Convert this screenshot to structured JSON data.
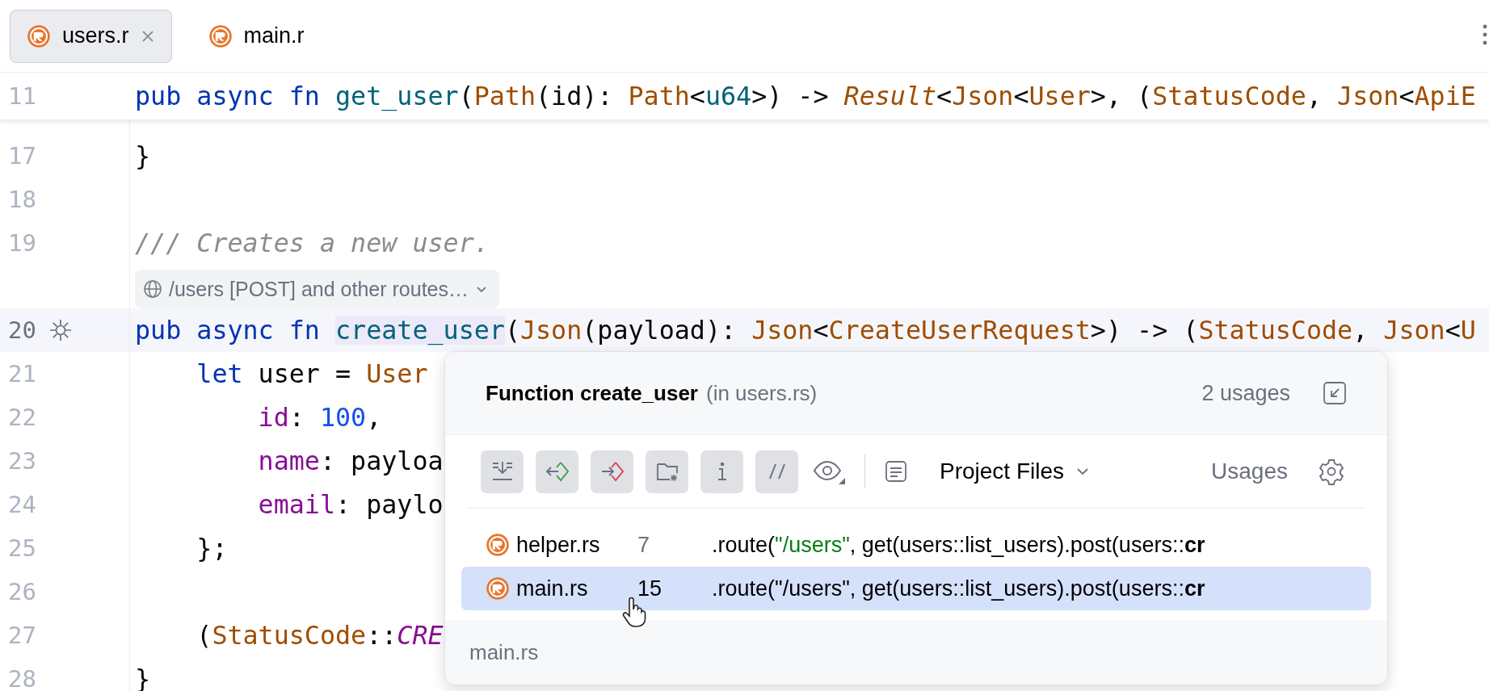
{
  "tabs": [
    {
      "label": "users.r",
      "selected": true,
      "closable": true
    },
    {
      "label": "main.r",
      "selected": false,
      "closable": false
    }
  ],
  "sticky_line": {
    "number": "11",
    "tokens": [
      {
        "text": "pub async fn ",
        "kind": "keyword"
      },
      {
        "text": "get_user",
        "kind": "function"
      },
      {
        "text": "(",
        "kind": "plain"
      },
      {
        "text": "Path",
        "kind": "type"
      },
      {
        "text": "(id): ",
        "kind": "plain"
      },
      {
        "text": "Path",
        "kind": "type"
      },
      {
        "text": "<",
        "kind": "plain"
      },
      {
        "text": "u64",
        "kind": "primitive"
      },
      {
        "text": ">) -> ",
        "kind": "plain"
      },
      {
        "text": "Result",
        "kind": "type_italic"
      },
      {
        "text": "<",
        "kind": "plain"
      },
      {
        "text": "Json",
        "kind": "type"
      },
      {
        "text": "<",
        "kind": "plain"
      },
      {
        "text": "User",
        "kind": "type"
      },
      {
        "text": ">, (",
        "kind": "plain"
      },
      {
        "text": "StatusCode",
        "kind": "type"
      },
      {
        "text": ", ",
        "kind": "plain"
      },
      {
        "text": "Json",
        "kind": "type"
      },
      {
        "text": "<",
        "kind": "plain"
      },
      {
        "text": "ApiE",
        "kind": "type"
      }
    ]
  },
  "code_lines": [
    {
      "kind": "code",
      "number": "17",
      "current": false,
      "gutter_icon": false,
      "tokens": [
        {
          "text": "}",
          "kind": "plain"
        }
      ]
    },
    {
      "kind": "code",
      "number": "18",
      "current": false,
      "gutter_icon": false
    },
    {
      "kind": "code",
      "number": "19",
      "current": false,
      "gutter_icon": false,
      "tokens": [
        {
          "text": "/// Creates a new user.",
          "kind": "comment"
        }
      ]
    },
    {
      "kind": "hint",
      "text": "/users [POST] and other routes…"
    },
    {
      "kind": "code",
      "number": "20",
      "current": true,
      "gutter_icon": true,
      "tokens": [
        {
          "text": "pub async fn ",
          "kind": "keyword"
        },
        {
          "text": "create_user",
          "kind": "usage"
        },
        {
          "text": "(",
          "kind": "plain"
        },
        {
          "text": "Json",
          "kind": "type"
        },
        {
          "text": "(payload): ",
          "kind": "plain"
        },
        {
          "text": "Json",
          "kind": "type"
        },
        {
          "text": "<",
          "kind": "plain"
        },
        {
          "text": "CreateUserRequest",
          "kind": "type"
        },
        {
          "text": ">) -> (",
          "kind": "plain"
        },
        {
          "text": "StatusCode",
          "kind": "type"
        },
        {
          "text": ", ",
          "kind": "plain"
        },
        {
          "text": "Json",
          "kind": "type"
        },
        {
          "text": "<",
          "kind": "plain"
        },
        {
          "text": "U",
          "kind": "type"
        }
      ]
    },
    {
      "kind": "code",
      "number": "21",
      "current": false,
      "gutter_icon": false,
      "tokens": [
        {
          "text": "    let",
          "kind": "keyword"
        },
        {
          "text": " user = ",
          "kind": "plain"
        },
        {
          "text": "User",
          "kind": "type"
        }
      ]
    },
    {
      "kind": "code",
      "number": "22",
      "current": false,
      "gutter_icon": false,
      "tokens": [
        {
          "text": "        id",
          "kind": "field"
        },
        {
          "text": ": ",
          "kind": "plain"
        },
        {
          "text": "100",
          "kind": "number"
        },
        {
          "text": ",",
          "kind": "plain"
        }
      ]
    },
    {
      "kind": "code",
      "number": "23",
      "current": false,
      "gutter_icon": false,
      "tokens": [
        {
          "text": "        name",
          "kind": "field"
        },
        {
          "text": ": payloa",
          "kind": "plain"
        }
      ]
    },
    {
      "kind": "code",
      "number": "24",
      "current": false,
      "gutter_icon": false,
      "tokens": [
        {
          "text": "        email",
          "kind": "field"
        },
        {
          "text": ": paylo",
          "kind": "plain"
        }
      ]
    },
    {
      "kind": "code",
      "number": "25",
      "current": false,
      "gutter_icon": false,
      "tokens": [
        {
          "text": "    };",
          "kind": "plain"
        }
      ]
    },
    {
      "kind": "code",
      "number": "26",
      "current": false,
      "gutter_icon": false
    },
    {
      "kind": "code",
      "number": "27",
      "current": false,
      "gutter_icon": false,
      "tokens": [
        {
          "text": "    (",
          "kind": "plain"
        },
        {
          "text": "StatusCode",
          "kind": "type"
        },
        {
          "text": "::",
          "kind": "plain"
        },
        {
          "text": "CRE",
          "kind": "constant_italic"
        }
      ]
    },
    {
      "kind": "code",
      "number": "28",
      "current": false,
      "gutter_icon": false,
      "tokens": [
        {
          "text": "}",
          "kind": "plain"
        }
      ]
    }
  ],
  "popup": {
    "title": "Function create_user",
    "context": "(in users.rs)",
    "count": "2 usages",
    "toolbar": [
      {
        "kind": "merge",
        "selected": true
      },
      {
        "kind": "read",
        "selected": true
      },
      {
        "kind": "write",
        "selected": true
      },
      {
        "kind": "folder",
        "selected": true
      },
      {
        "kind": "info",
        "selected": true
      },
      {
        "kind": "comment",
        "selected": true
      }
    ],
    "scope": "Project Files",
    "type_label": "Usages",
    "usages": [
      {
        "file": "helper.rs",
        "line": "7",
        "selected": false,
        "snippet": [
          {
            "text": ".route(",
            "kind": "plain"
          },
          {
            "text": "\"/users\"",
            "kind": "string"
          },
          {
            "text": ", get(users::list_users).post(users::",
            "kind": "plain"
          },
          {
            "text": "cr",
            "kind": "match"
          }
        ]
      },
      {
        "file": "main.rs",
        "line": "15",
        "selected": true,
        "snippet": [
          {
            "text": ".route(",
            "kind": "plain"
          },
          {
            "text": "\"/users\"",
            "kind": "string"
          },
          {
            "text": ", get(users::list_users).post(users::",
            "kind": "plain"
          },
          {
            "text": "cr",
            "kind": "match"
          }
        ]
      }
    ],
    "footer": "main.rs"
  }
}
